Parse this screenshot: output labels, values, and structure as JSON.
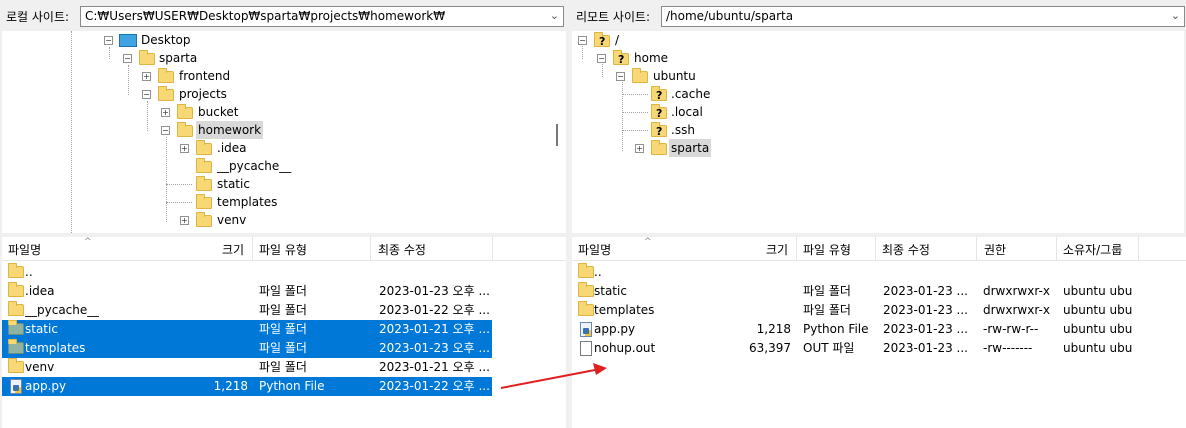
{
  "local": {
    "site_label": "로컬 사이트:",
    "path": "C:₩Users₩USER₩Desktop₩sparta₩projects₩homework₩",
    "tree": [
      {
        "label": "Desktop",
        "type": "pc"
      },
      {
        "label": "sparta"
      },
      {
        "label": "frontend"
      },
      {
        "label": "projects"
      },
      {
        "label": "bucket"
      },
      {
        "label": "homework",
        "selected": true
      },
      {
        "label": ".idea"
      },
      {
        "label": "__pycache__"
      },
      {
        "label": "static"
      },
      {
        "label": "templates"
      },
      {
        "label": "venv"
      }
    ],
    "columns": [
      "파일명",
      "크기",
      "파일 유형",
      "최종 수정"
    ],
    "rows": [
      {
        "name": "..",
        "size": "",
        "type": "",
        "modified": "",
        "icon": "folder",
        "selected": false
      },
      {
        "name": ".idea",
        "size": "",
        "type": "파일 폴더",
        "modified": "2023-01-23 오후 ...",
        "icon": "folder",
        "selected": false
      },
      {
        "name": "__pycache__",
        "size": "",
        "type": "파일 폴더",
        "modified": "2023-01-22 오후 ...",
        "icon": "folder",
        "selected": false
      },
      {
        "name": "static",
        "size": "",
        "type": "파일 폴더",
        "modified": "2023-01-21 오후 ...",
        "icon": "folder",
        "selected": true
      },
      {
        "name": "templates",
        "size": "",
        "type": "파일 폴더",
        "modified": "2023-01-23 오후 ...",
        "icon": "folder",
        "selected": true
      },
      {
        "name": "venv",
        "size": "",
        "type": "파일 폴더",
        "modified": "2023-01-21 오후 ...",
        "icon": "folder",
        "selected": false
      },
      {
        "name": "app.py",
        "size": "1,218",
        "type": "Python File",
        "modified": "2023-01-22 오후 ...",
        "icon": "python",
        "selected": true
      }
    ]
  },
  "remote": {
    "site_label": "리모트 사이트:",
    "path": "/home/ubuntu/sparta",
    "tree": [
      {
        "label": "/",
        "type": "q"
      },
      {
        "label": "home",
        "type": "q"
      },
      {
        "label": "ubuntu"
      },
      {
        "label": ".cache",
        "type": "q"
      },
      {
        "label": ".local",
        "type": "q"
      },
      {
        "label": ".ssh",
        "type": "q"
      },
      {
        "label": "sparta",
        "selected": true
      }
    ],
    "columns": [
      "파일명",
      "크기",
      "파일 유형",
      "최종 수정",
      "권한",
      "소유자/그룹"
    ],
    "rows": [
      {
        "name": "..",
        "size": "",
        "type": "",
        "modified": "",
        "perm": "",
        "owner": "",
        "icon": "folder"
      },
      {
        "name": "static",
        "size": "",
        "type": "파일 폴더",
        "modified": "2023-01-23 ...",
        "perm": "drwxrwxr-x",
        "owner": "ubuntu ubu",
        "icon": "folder"
      },
      {
        "name": "templates",
        "size": "",
        "type": "파일 폴더",
        "modified": "2023-01-23 ...",
        "perm": "drwxrwxr-x",
        "owner": "ubuntu ubu",
        "icon": "folder"
      },
      {
        "name": "app.py",
        "size": "1,218",
        "type": "Python File",
        "modified": "2023-01-23 ...",
        "perm": "-rw-rw-r--",
        "owner": "ubuntu ubu",
        "icon": "python"
      },
      {
        "name": "nohup.out",
        "size": "63,397",
        "type": "OUT 파일",
        "modified": "2023-01-23 ...",
        "perm": "-rw-------",
        "owner": "ubuntu ubu",
        "icon": "doc"
      }
    ]
  },
  "colors": {
    "selection": "#0078d7",
    "annotation_arrow": "#e02020",
    "folder": "#f8d775"
  }
}
